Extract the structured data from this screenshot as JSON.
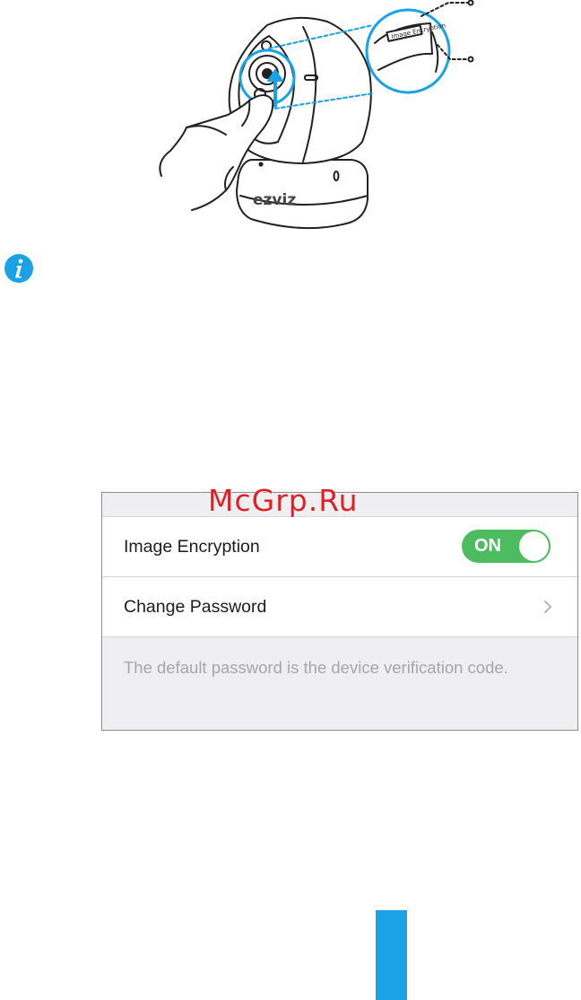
{
  "illustration": {
    "brand_text": "ezviz",
    "qr_label_text": "Image Encryption"
  },
  "watermark": "McGrp.Ru",
  "settings": {
    "image_encryption_label": "Image Encryption",
    "toggle_text": "ON",
    "change_password_label": "Change Password",
    "note": "The default password is the device verification code."
  },
  "colors": {
    "toggle_on": "#4dbb5f",
    "accent_blue": "#1aa1e6",
    "watermark_red": "#e51c24"
  },
  "icons": {
    "info": "info-icon",
    "chevron": "chevron-right-icon"
  }
}
